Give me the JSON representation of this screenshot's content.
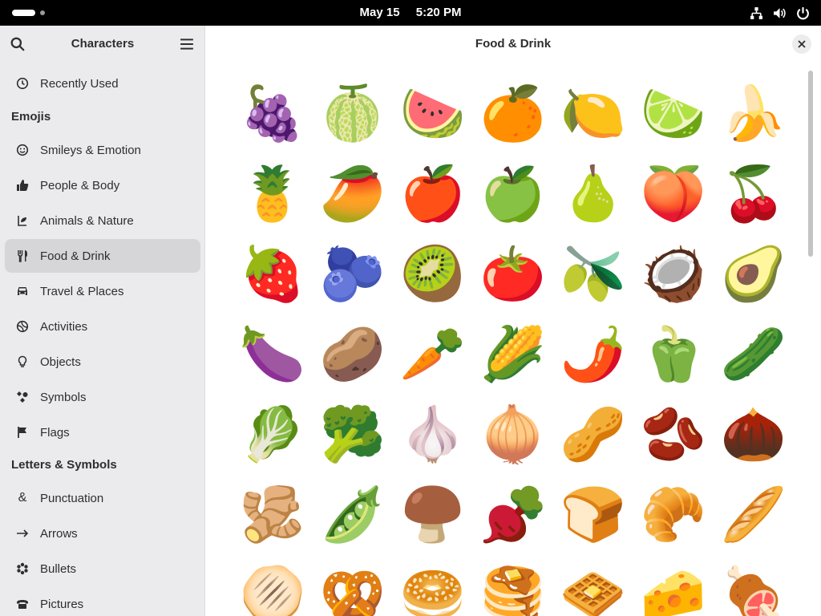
{
  "topbar": {
    "date": "May 15",
    "time": "5:20 PM",
    "tray_icons": [
      "network-icon",
      "volume-icon",
      "power-icon"
    ]
  },
  "sidebar": {
    "title": "Characters",
    "items": [
      {
        "label": "Recently Used",
        "icon": "clock-icon"
      },
      {
        "label": "Smileys & Emotion",
        "icon": "smiley-icon"
      },
      {
        "label": "People & Body",
        "icon": "thumbs-up-icon"
      },
      {
        "label": "Animals & Nature",
        "icon": "nature-icon"
      },
      {
        "label": "Food & Drink",
        "icon": "fork-knife-icon"
      },
      {
        "label": "Travel & Places",
        "icon": "car-icon"
      },
      {
        "label": "Activities",
        "icon": "ball-icon"
      },
      {
        "label": "Objects",
        "icon": "bulb-icon"
      },
      {
        "label": "Symbols",
        "icon": "symbols-icon"
      },
      {
        "label": "Flags",
        "icon": "flag-icon"
      },
      {
        "label": "Punctuation",
        "icon": "ampersand-icon"
      },
      {
        "label": "Arrows",
        "icon": "arrow-icon"
      },
      {
        "label": "Bullets",
        "icon": "asterisk-icon"
      },
      {
        "label": "Pictures",
        "icon": "phone-icon"
      }
    ],
    "sections": [
      "Emojis",
      "Letters & Symbols"
    ],
    "selected": "Food & Drink"
  },
  "main": {
    "title": "Food & Drink",
    "emojis": [
      [
        "🍇",
        "🍈",
        "🍉",
        "🍊",
        "🍋",
        "🍋‍🟩",
        "🍌"
      ],
      [
        "🍍",
        "🥭",
        "🍎",
        "🍏",
        "🍐",
        "🍑",
        "🍒"
      ],
      [
        "🍓",
        "🫐",
        "🥝",
        "🍅",
        "🫒",
        "🥥",
        "🥑"
      ],
      [
        "🍆",
        "🥔",
        "🥕",
        "🌽",
        "🌶️",
        "🫑",
        "🥒"
      ],
      [
        "🥬",
        "🥦",
        "🧄",
        "🧅",
        "🥜",
        "🫘",
        "🌰"
      ],
      [
        "🫚",
        "🫛",
        "🍄‍🟫",
        "🫜",
        "🍞",
        "🥐",
        "🥖"
      ],
      [
        "🫓",
        "🥨",
        "🥯",
        "🥞",
        "🧇",
        "🧀",
        "🍖"
      ]
    ]
  },
  "colors": {
    "sidebar_bg": "#ebebed",
    "selected_bg": "#d6d6d8",
    "topbar_bg": "#000000"
  }
}
